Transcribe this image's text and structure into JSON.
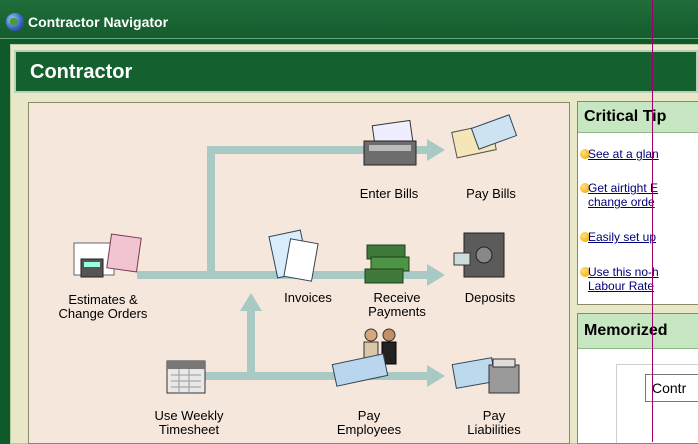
{
  "window": {
    "title": "Contractor Navigator"
  },
  "header": {
    "title": "Contractor"
  },
  "workflow": {
    "estimates": "Estimates &\nChange Orders",
    "enter_bills": "Enter Bills",
    "pay_bills": "Pay Bills",
    "invoices": "Invoices",
    "receive_payments": "Receive\nPayments",
    "deposits": "Deposits",
    "timesheet": "Use Weekly\nTimesheet",
    "pay_employees": "Pay\nEmployees",
    "pay_liabilities": "Pay\nLiabilities"
  },
  "tips": {
    "title": "Critical Tip",
    "items": [
      {
        "text": "See at a glan"
      },
      {
        "text": "Get airtight E",
        "text2": "change orde"
      },
      {
        "text": "Easily set up"
      },
      {
        "text": "Use this no-h",
        "text2": "Labour Rate"
      }
    ]
  },
  "memorized": {
    "title": "Memorized",
    "combo_value": "Contr"
  }
}
